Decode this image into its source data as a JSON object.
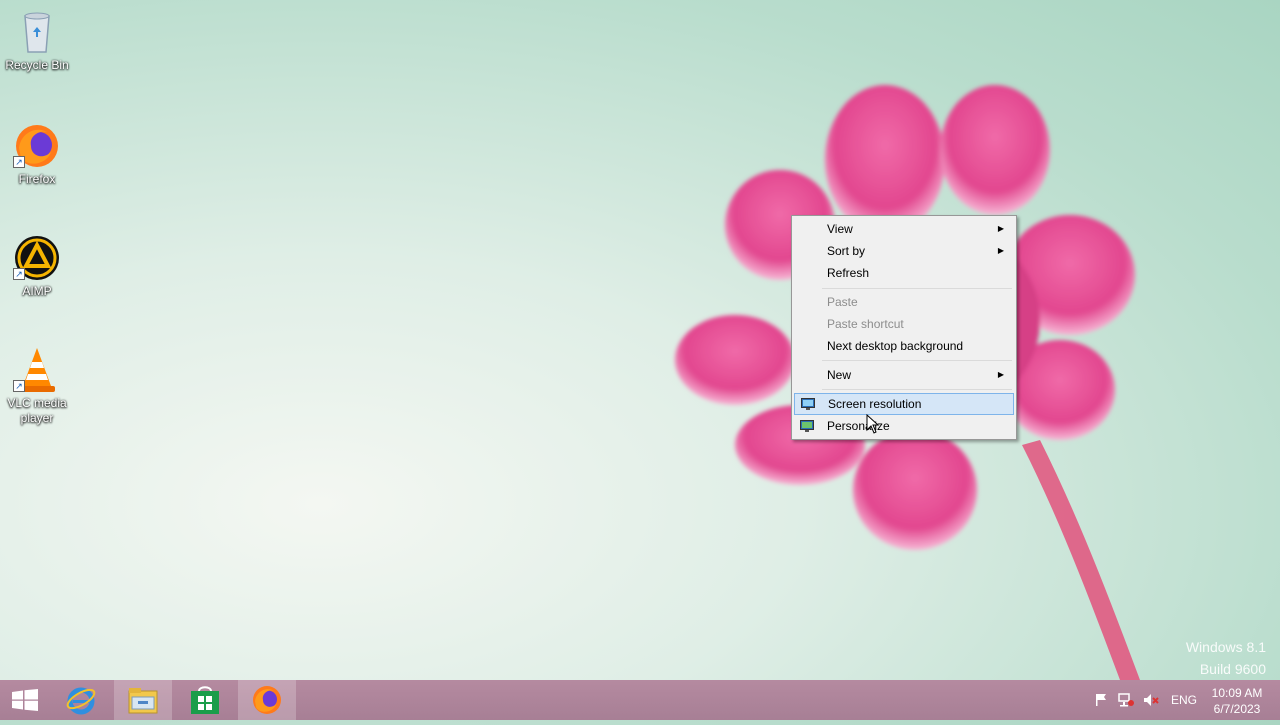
{
  "desktop": {
    "icons": [
      {
        "label": "Recycle Bin",
        "icon": "recycle-bin-icon"
      },
      {
        "label": "Firefox",
        "icon": "firefox-icon"
      },
      {
        "label": "AIMP",
        "icon": "aimp-icon"
      },
      {
        "label": "VLC media player",
        "icon": "vlc-icon"
      }
    ],
    "watermark": {
      "line1": "Windows 8.1",
      "line2": "Build 9600"
    }
  },
  "context_menu": {
    "items": [
      {
        "label": "View",
        "submenu": true
      },
      {
        "label": "Sort by",
        "submenu": true
      },
      {
        "label": "Refresh"
      },
      {
        "label": "Paste",
        "disabled": true
      },
      {
        "label": "Paste shortcut",
        "disabled": true
      },
      {
        "label": "Next desktop background"
      },
      {
        "label": "New",
        "submenu": true
      },
      {
        "label": "Screen resolution",
        "icon": "monitor-icon",
        "highlighted": true
      },
      {
        "label": "Personalize",
        "icon": "personalize-icon"
      }
    ]
  },
  "taskbar": {
    "buttons": [
      {
        "name": "start-button",
        "icon": "windows-logo-icon"
      },
      {
        "name": "internet-explorer",
        "icon": "internet-explorer-icon"
      },
      {
        "name": "file-explorer",
        "icon": "file-explorer-icon",
        "active": true
      },
      {
        "name": "store",
        "icon": "store-icon"
      },
      {
        "name": "firefox",
        "icon": "firefox-icon",
        "active": true
      }
    ],
    "tray": {
      "language": "ENG",
      "time": "10:09 AM",
      "date": "6/7/2023",
      "icons": [
        "flag-icon",
        "network-icon",
        "volume-muted-icon"
      ]
    }
  },
  "colors": {
    "menu_highlight": "#d5e6f7",
    "menu_highlight_border": "#7eb4ea",
    "taskbar": "#a97f96"
  }
}
